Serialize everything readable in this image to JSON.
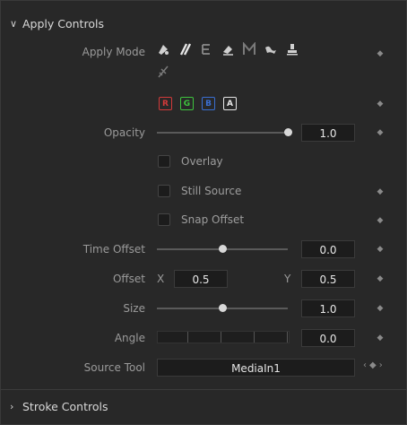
{
  "apply_controls": {
    "title": "Apply Controls"
  },
  "apply_mode": {
    "label": "Apply Mode",
    "modes": [
      "paint-mode-icon",
      "brush-mode-icon",
      "erase-mode-icon",
      "eraser-mode-icon",
      "merge-mode-icon",
      "smear-mode-icon",
      "stamp-mode-icon",
      "wire-mode-icon"
    ]
  },
  "channels": {
    "r": "R",
    "g": "G",
    "b": "B",
    "a": "A",
    "colors": {
      "r": "#d23a3a",
      "g": "#3ec43e",
      "b": "#3a6fd2",
      "a": "#e6e6e6"
    }
  },
  "opacity": {
    "label": "Opacity",
    "value": "1.0",
    "level": 1.0
  },
  "overlay": {
    "label": "Overlay"
  },
  "still_source": {
    "label": "Still Source"
  },
  "snap_offset": {
    "label": "Snap Offset"
  },
  "time_offset": {
    "label": "Time Offset",
    "value": "0.0",
    "level": 0.5
  },
  "offset": {
    "label": "Offset",
    "x_label": "X",
    "x_value": "0.5",
    "y_label": "Y",
    "y_value": "0.5"
  },
  "size": {
    "label": "Size",
    "value": "1.0",
    "level": 0.5
  },
  "angle": {
    "label": "Angle",
    "value": "0.0"
  },
  "source_tool": {
    "label": "Source Tool",
    "value": "MediaIn1"
  },
  "stroke_controls": {
    "title": "Stroke Controls"
  }
}
